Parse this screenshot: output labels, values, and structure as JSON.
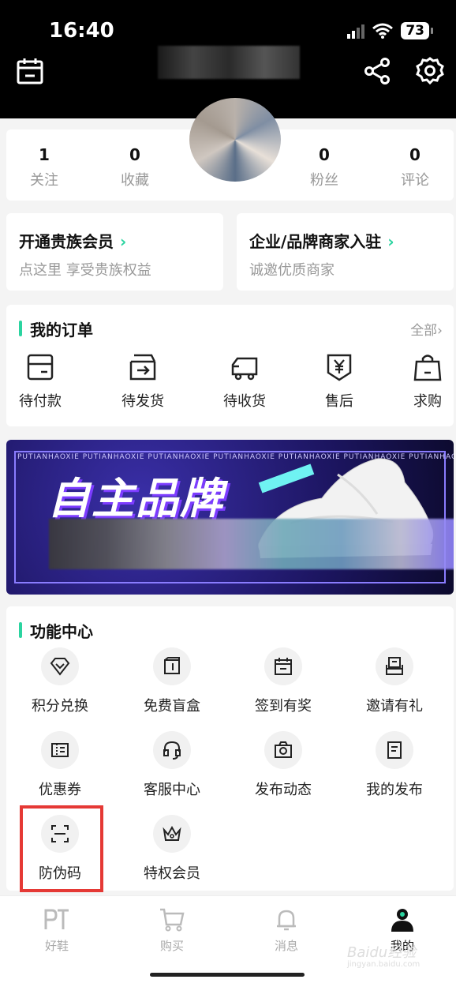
{
  "status_bar": {
    "time": "16:40",
    "battery": "73"
  },
  "header": {
    "calendar_icon": "calendar-icon",
    "share_icon": "share-icon",
    "settings_icon": "gear-icon"
  },
  "stats": [
    {
      "num": "1",
      "label": "关注"
    },
    {
      "num": "0",
      "label": "收藏"
    },
    {
      "num": "0",
      "label": "粉丝"
    },
    {
      "num": "0",
      "label": "评论"
    }
  ],
  "promo": {
    "vip": {
      "title": "开通贵族会员",
      "arrow": "›",
      "subtitle": "点这里 享受贵族权益"
    },
    "merchant": {
      "title": "企业/品牌商家入驻",
      "arrow": "›",
      "subtitle": "诚邀优质商家"
    }
  },
  "orders": {
    "title": "我的订单",
    "more": "全部›",
    "items": [
      {
        "label": "待付款",
        "icon": "wallet-icon"
      },
      {
        "label": "待发货",
        "icon": "box-out-icon"
      },
      {
        "label": "待收货",
        "icon": "truck-icon"
      },
      {
        "label": "售后",
        "icon": "yen-shield-icon"
      },
      {
        "label": "求购",
        "icon": "bag-icon"
      }
    ]
  },
  "banner": {
    "strip": "PUTIANHAOXIE PUTIANHAOXIE PUTIANHAOXIE PUTIANHAOXIE PUTIANHAOXIE PUTIANHAOXIE PUTIANHAOXIE PUT",
    "title": "自主品牌"
  },
  "functions": {
    "title": "功能中心",
    "items": [
      {
        "label": "积分兑换",
        "icon": "diamond-icon"
      },
      {
        "label": "免费盲盒",
        "icon": "box-icon"
      },
      {
        "label": "签到有奖",
        "icon": "calendar-check-icon"
      },
      {
        "label": "邀请有礼",
        "icon": "invite-icon"
      },
      {
        "label": "优惠券",
        "icon": "coupon-icon"
      },
      {
        "label": "客服中心",
        "icon": "headset-icon"
      },
      {
        "label": "发布动态",
        "icon": "camera-icon"
      },
      {
        "label": "我的发布",
        "icon": "document-icon"
      },
      {
        "label": "防伪码",
        "icon": "scan-icon"
      },
      {
        "label": "特权会员",
        "icon": "crown-icon"
      }
    ]
  },
  "tabbar": [
    {
      "label": "好鞋",
      "icon": "pt-logo-icon"
    },
    {
      "label": "购买",
      "icon": "buy-cart-icon"
    },
    {
      "label": "消息",
      "icon": "bell-icon"
    },
    {
      "label": "我的",
      "icon": "user-icon"
    }
  ],
  "watermark": {
    "line1": "Baidu经验",
    "line2": "jingyan.baidu.com"
  },
  "colors": {
    "accent": "#2bd4a0",
    "highlight": "#e53935",
    "header_bg": "#000000"
  }
}
